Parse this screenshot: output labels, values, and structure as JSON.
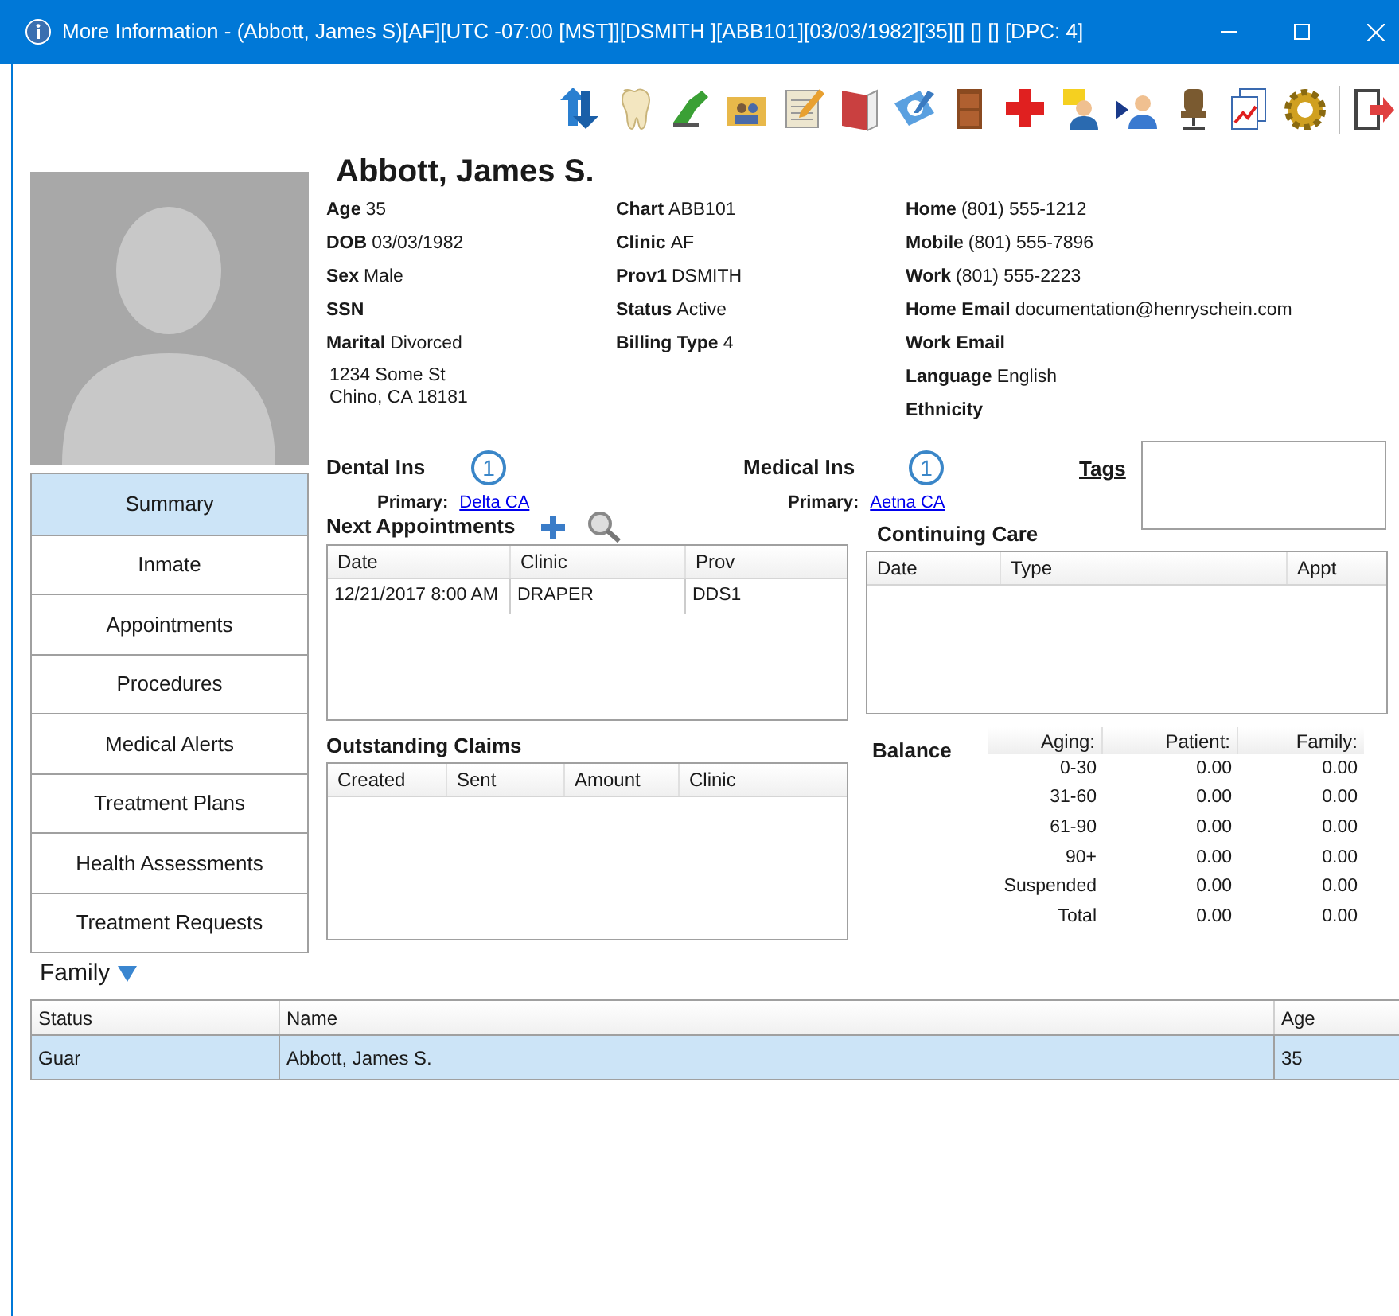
{
  "window": {
    "title": "More Information - (Abbott, James S)[AF][UTC -07:00 [MST]][DSMITH ][ABB101][03/03/1982][35][] [] [] [DPC: 4]"
  },
  "patient": {
    "name": "Abbott, James S.",
    "col_1": [
      {
        "label": "Age",
        "value": "35"
      },
      {
        "label": "DOB",
        "value": "03/03/1982"
      },
      {
        "label": "Sex",
        "value": "Male"
      },
      {
        "label": "SSN"
      },
      {
        "label": "Marital",
        "value": "Divorced"
      }
    ],
    "address": [
      "1234 Some St",
      "Chino, CA 18181"
    ],
    "col_2": [
      {
        "label": "Chart",
        "value": "ABB101"
      },
      {
        "label": "Clinic",
        "value": "AF"
      },
      {
        "label": "Prov1",
        "value": "DSMITH"
      },
      {
        "label": "Status",
        "value": "Active"
      },
      {
        "label": "Billing Type",
        "value": "4"
      }
    ],
    "col_3": [
      {
        "label": "Home",
        "value": "(801) 555-1212"
      },
      {
        "label": "Mobile",
        "value": "(801) 555-7896"
      },
      {
        "label": "Work",
        "value": "(801) 555-2223"
      },
      {
        "label": "Home Email",
        "value": "documentation@henryschein.com"
      },
      {
        "label": "Work Email"
      },
      {
        "label": "Language",
        "value": "English"
      },
      {
        "label": "Ethnicity"
      }
    ]
  },
  "sidebar": {
    "items": [
      {
        "label": "Summary",
        "selected": true
      },
      {
        "label": "Inmate",
        "selected": false
      },
      {
        "label": "Appointments",
        "selected": false
      },
      {
        "label": "Procedures",
        "selected": false
      },
      {
        "label": "Medical Alerts",
        "selected": false
      },
      {
        "label": "Treatment Plans",
        "selected": false
      },
      {
        "label": "Health Assessments",
        "selected": false
      },
      {
        "label": "Treatment Requests",
        "selected": false
      }
    ]
  },
  "dental_ins": {
    "title": "Dental Ins",
    "badge": "1",
    "primary_label": "Primary:",
    "primary": "Delta CA"
  },
  "medical_ins": {
    "title": "Medical Ins",
    "badge": "1",
    "primary_label": "Primary:",
    "primary": "Aetna CA"
  },
  "tags": {
    "title": "Tags"
  },
  "next_appointments": {
    "title": "Next Appointments",
    "columns": [
      "Date",
      "Clinic",
      "Prov"
    ],
    "rows": [
      [
        "12/21/2017 8:00 AM",
        "DRAPER",
        "DDS1"
      ]
    ]
  },
  "continuing_care": {
    "title": "Continuing Care",
    "columns": [
      "Date",
      "Type",
      "Appt"
    ]
  },
  "outstanding_claims": {
    "title": "Outstanding Claims",
    "columns": [
      "Created",
      "Sent",
      "Amount",
      "Clinic"
    ]
  },
  "balance": {
    "title": "Balance",
    "columns": [
      "Aging:",
      "Patient:",
      "Family:"
    ],
    "rows": [
      [
        "0-30",
        "0.00",
        "0.00"
      ],
      [
        "31-60",
        "0.00",
        "0.00"
      ],
      [
        "61-90",
        "0.00",
        "0.00"
      ],
      [
        "90+",
        "0.00",
        "0.00"
      ],
      [
        "Suspended",
        "0.00",
        "0.00"
      ],
      [
        "Total",
        "0.00",
        "0.00"
      ]
    ]
  },
  "family": {
    "title": "Family",
    "columns": [
      "Status",
      "Name",
      "Age"
    ],
    "rows": [
      {
        "cells": [
          "Guar",
          "Abbott, James S.",
          "35"
        ],
        "selected": true
      }
    ]
  }
}
